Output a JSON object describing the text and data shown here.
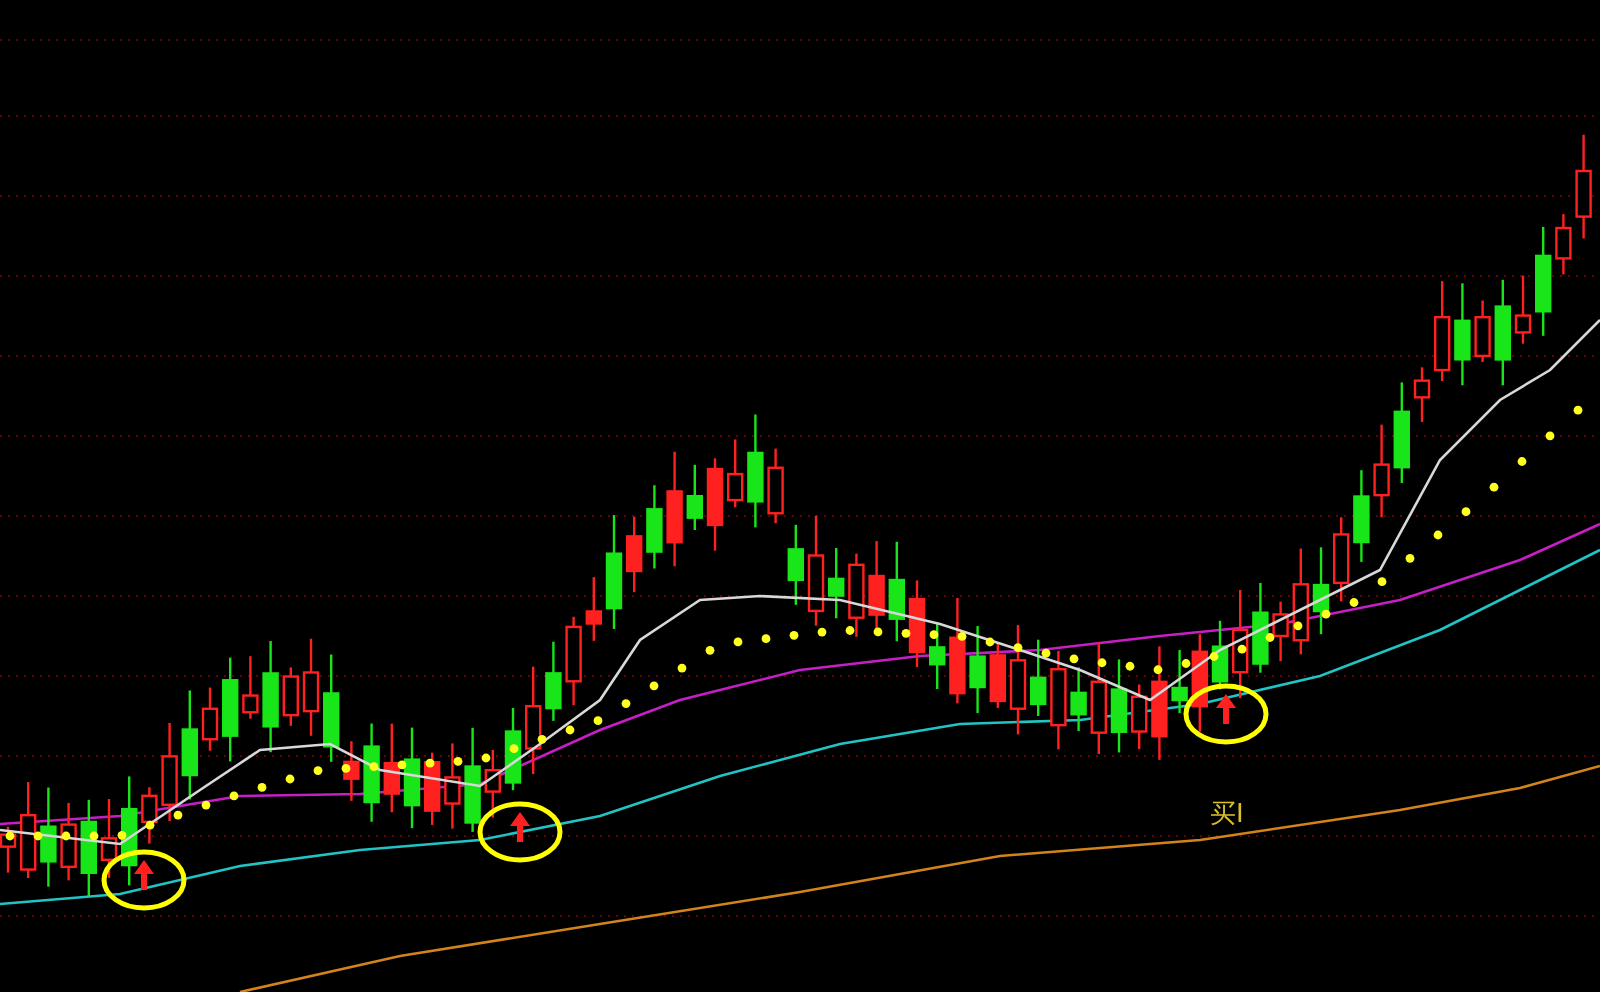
{
  "chart": {
    "signal_label": "买I"
  }
}
